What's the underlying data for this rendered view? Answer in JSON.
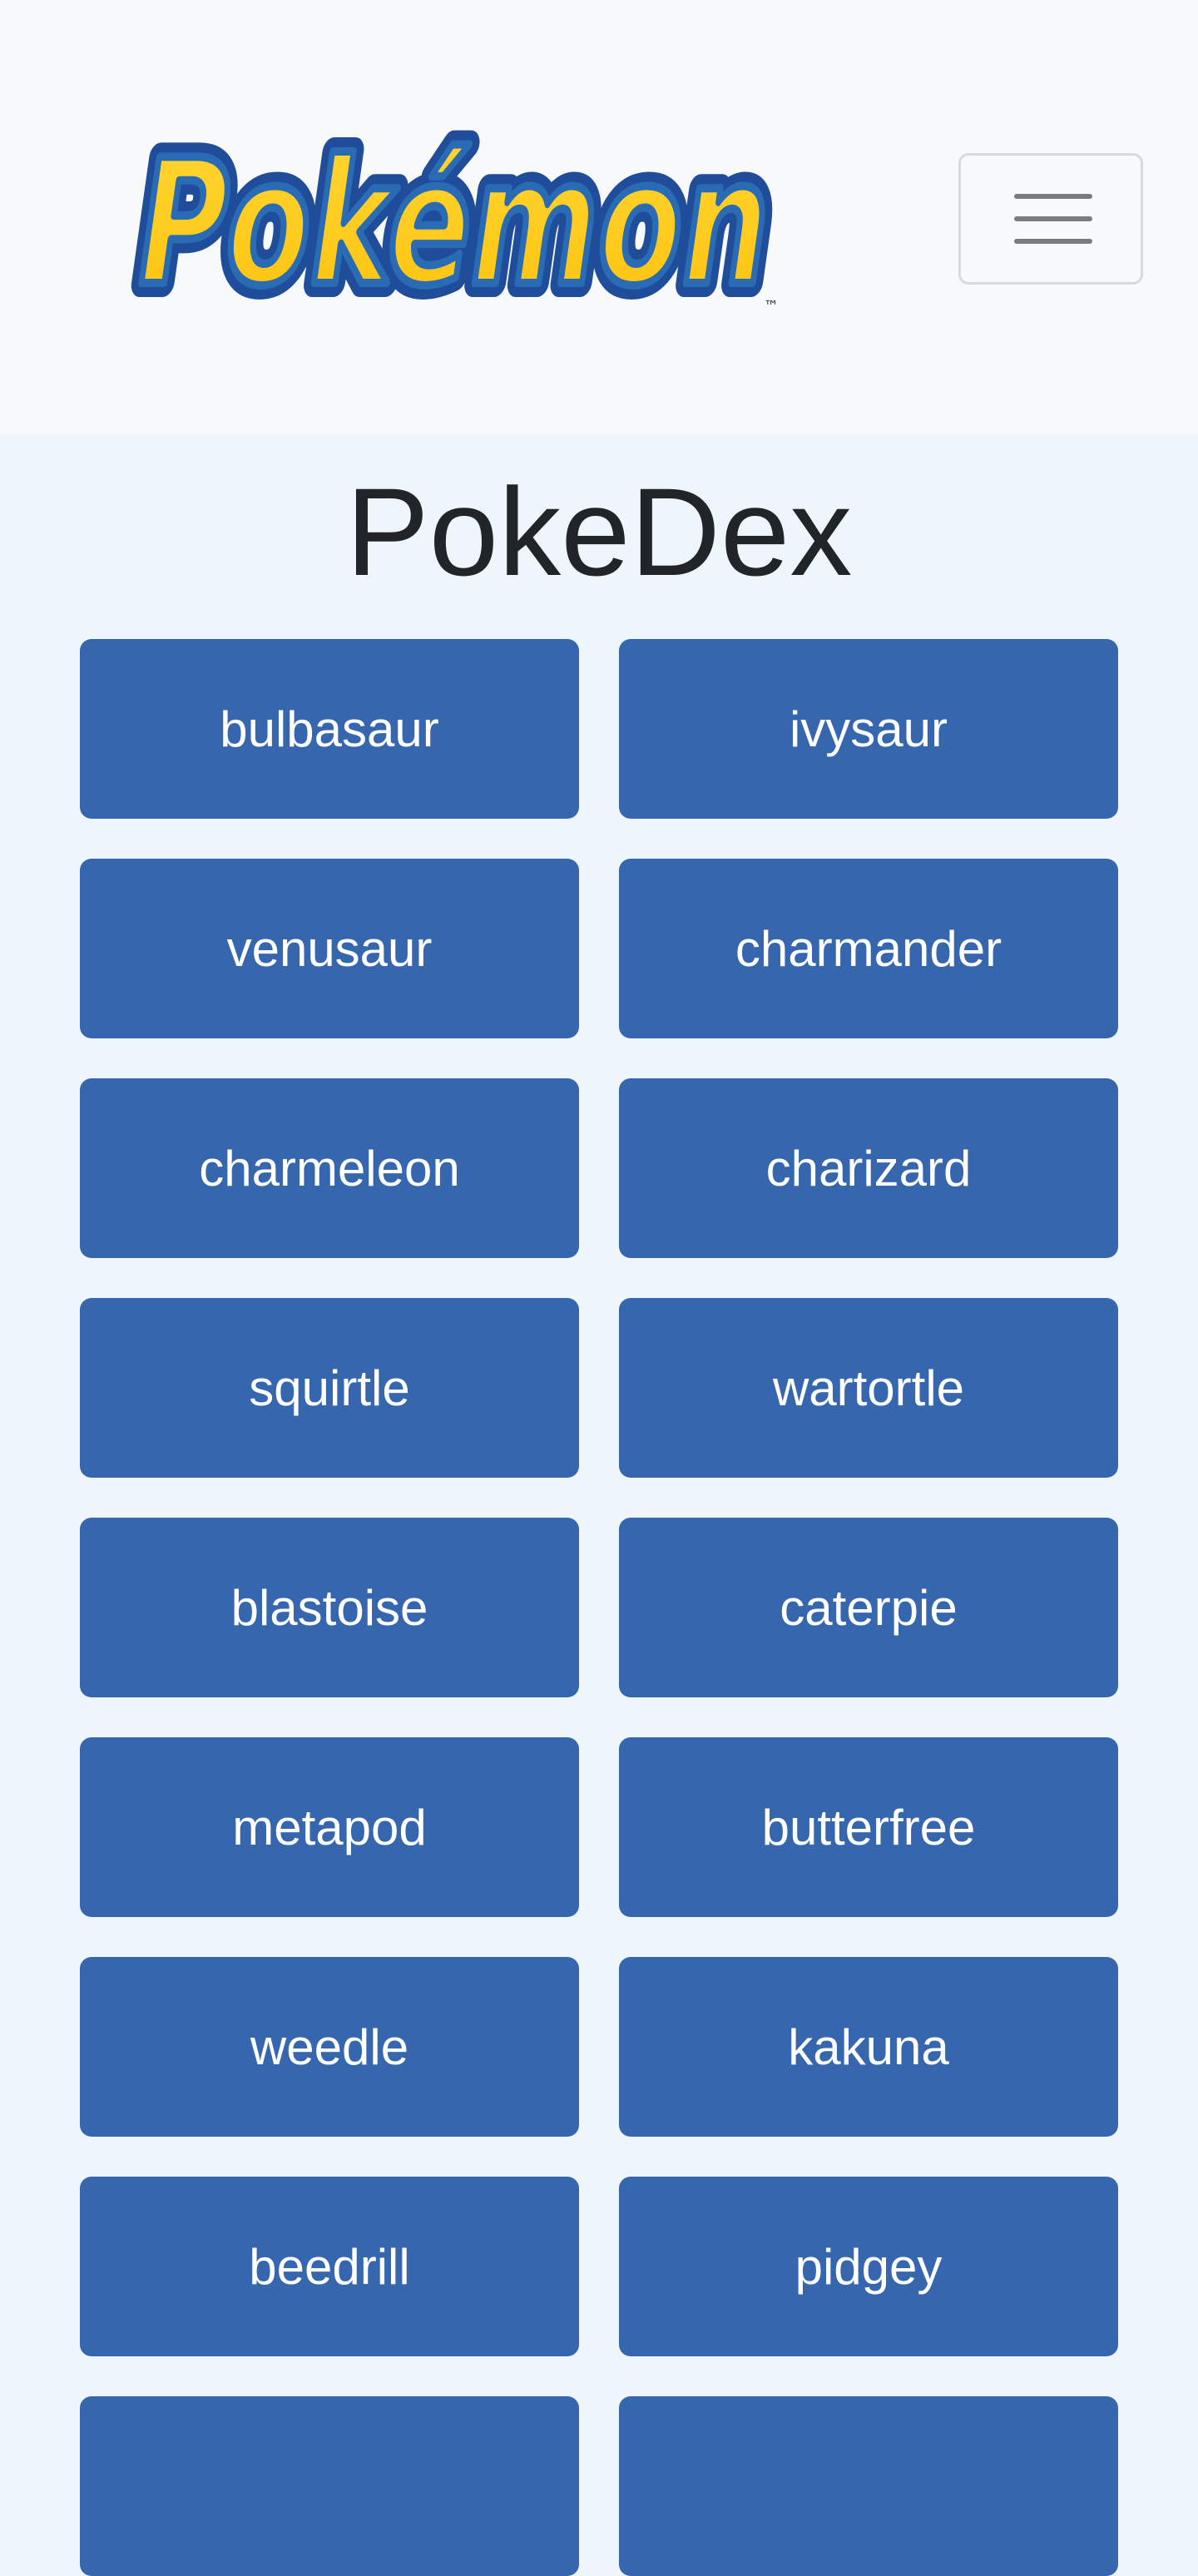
{
  "navbar": {
    "logo_text": "Pokémon",
    "logo_trademark": "™",
    "menu_icon": "hamburger-menu-icon"
  },
  "colors": {
    "navbar_background": "#f7f9fb",
    "page_background": "#eef6fc",
    "button_background": "#3566ae",
    "button_text": "#ffffff",
    "logo_yellow": "#ffcb05",
    "logo_blue": "#2a6bb5"
  },
  "page": {
    "title": "PokeDex"
  },
  "pokemon": [
    "bulbasaur",
    "ivysaur",
    "venusaur",
    "charmander",
    "charmeleon",
    "charizard",
    "squirtle",
    "wartortle",
    "blastoise",
    "caterpie",
    "metapod",
    "butterfree",
    "weedle",
    "kakuna",
    "beedrill",
    "pidgey",
    "",
    ""
  ]
}
